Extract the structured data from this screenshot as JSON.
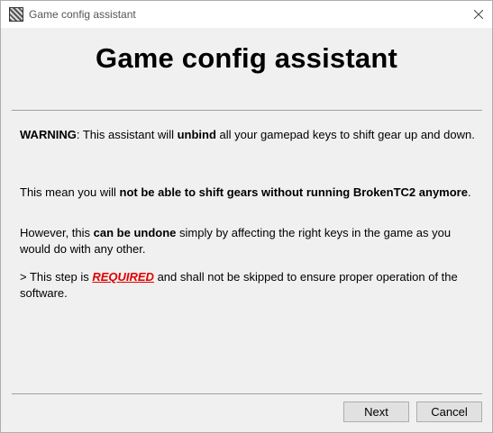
{
  "window": {
    "title": "Game config assistant",
    "app_icon": "checker-app-icon",
    "close_icon": "close-icon"
  },
  "main": {
    "heading": "Game config assistant",
    "p1": {
      "warning": "WARNING",
      "t1": ": This assistant will ",
      "unbind": "unbind",
      "t2": " all your gamepad keys to shift gear up and down."
    },
    "p2": {
      "t1": "This mean you will ",
      "bold": "not be able to shift gears without running BrokenTC2 anymore",
      "t2": "."
    },
    "p3": {
      "t1": "However, this ",
      "bold": "can be undone",
      "t2": " simply by affecting the right keys in the game as you would do with any other."
    },
    "p4": {
      "t1": "> This step is ",
      "required": "REQUIRED",
      "t2": " and shall not be skipped to ensure proper operation of the software."
    }
  },
  "buttons": {
    "next": "Next",
    "cancel": "Cancel"
  },
  "colors": {
    "required": "#e00000",
    "background": "#f0f0f0"
  }
}
